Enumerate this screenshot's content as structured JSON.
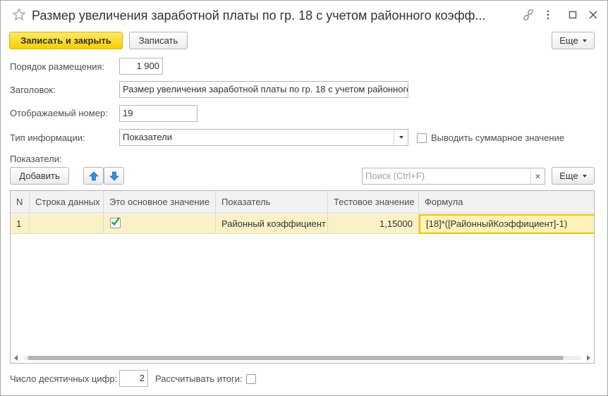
{
  "window": {
    "title": "Размер увеличения заработной платы по гр. 18 с учетом районного коэфф..."
  },
  "toolbar": {
    "save_close_label": "Записать и закрыть",
    "save_label": "Записать",
    "more_label": "Еще"
  },
  "form": {
    "order_label": "Порядок размещения:",
    "order_value": "1 900",
    "heading_label": "Заголовок:",
    "heading_value": "Размер увеличения заработной платы по гр. 18 с учетом районного",
    "display_number_label": "Отображаемый номер:",
    "display_number_value": "19",
    "info_type_label": "Тип информации:",
    "info_type_value": "Показатели",
    "show_total_label": "Выводить суммарное значение",
    "show_total_checked": false,
    "indicators_label": "Показатели:"
  },
  "table_toolbar": {
    "add_label": "Добавить",
    "search_placeholder": "Поиск (Ctrl+F)",
    "clear_symbol": "×",
    "more_label": "Еще"
  },
  "table": {
    "columns": [
      "N",
      "Строка данных",
      "Это основное значение",
      "Показатель",
      "Тестовое значение",
      "Формула"
    ],
    "rows": [
      {
        "n": "1",
        "data_row": "",
        "is_main": true,
        "indicator": "Районный коэффициент",
        "test_value": "1,15000",
        "formula": "[18]*([РайонныйКоэффициент]-1)"
      }
    ]
  },
  "footer": {
    "decimals_label": "Число десятичных цифр:",
    "decimals_value": "2",
    "calc_totals_label": "Рассчитывать итоги:",
    "calc_totals_checked": false
  },
  "colors": {
    "primary_button": "#f5cf00",
    "selected_row": "#fbf1c6",
    "arrow_blue": "#3b8ed8",
    "check_green": "#1b9b3a"
  }
}
